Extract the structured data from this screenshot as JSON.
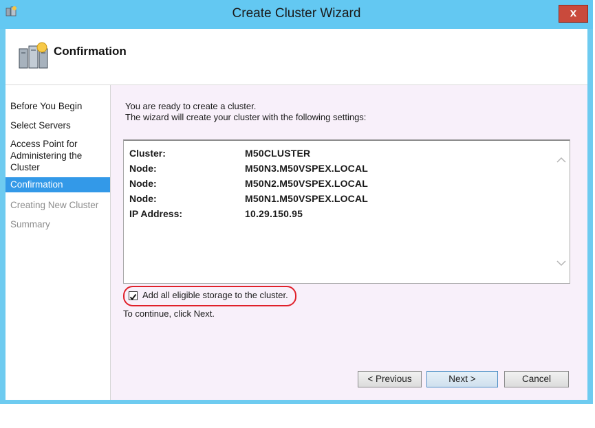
{
  "window": {
    "title": "Create Cluster Wizard",
    "close_label": "x"
  },
  "header": {
    "title": "Confirmation",
    "icon": "cluster-servers-icon"
  },
  "nav": {
    "items": [
      {
        "label": "Before You Begin",
        "state": "normal"
      },
      {
        "label": "Select Servers",
        "state": "normal"
      },
      {
        "label": "Access Point for Administering the Cluster",
        "state": "normal"
      },
      {
        "label": "Confirmation",
        "state": "active"
      },
      {
        "label": "Creating New Cluster",
        "state": "disabled"
      },
      {
        "label": "Summary",
        "state": "disabled"
      }
    ]
  },
  "content": {
    "intro_line1": "You are ready to create a cluster.",
    "intro_line2": "The wizard will create your cluster with the following settings:",
    "settings": [
      {
        "label": "Cluster:",
        "value": "M50CLUSTER"
      },
      {
        "label": "Node:",
        "value": "M50N3.M50VSPEX.LOCAL"
      },
      {
        "label": "Node:",
        "value": "M50N2.M50VSPEX.LOCAL"
      },
      {
        "label": "Node:",
        "value": "M50N1.M50VSPEX.LOCAL"
      },
      {
        "label": "IP Address:",
        "value": "10.29.150.95"
      }
    ],
    "checkbox_label": "Add all eligible storage to the cluster.",
    "checkbox_checked": true,
    "continue_text": "To continue, click Next."
  },
  "buttons": {
    "previous": "< Previous",
    "next": "Next >",
    "cancel": "Cancel"
  },
  "colors": {
    "titlebar": "#63c8f2",
    "selected_nav": "#3399e8",
    "content_bg": "#f8f0fa",
    "highlight_ring": "#e0202a",
    "close_button": "#c94a3c"
  }
}
